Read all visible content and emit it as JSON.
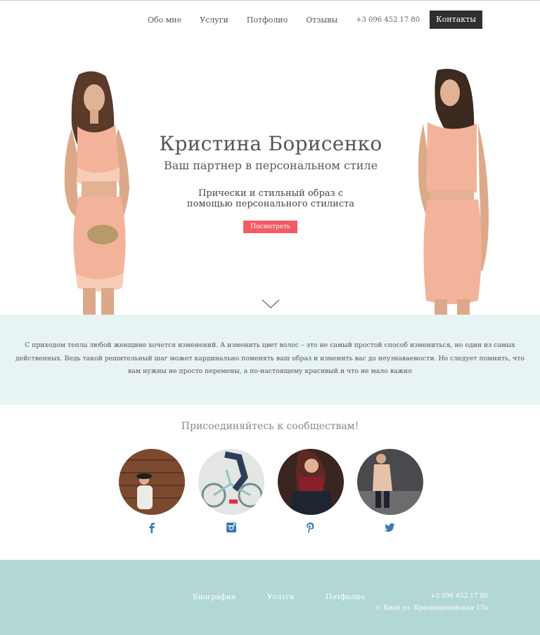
{
  "nav": {
    "items": [
      "Обо мне",
      "Услуги",
      "Потфолио",
      "Отзывы"
    ],
    "phone": "+3 096 452 17 80",
    "contacts_label": "Контакты"
  },
  "hero": {
    "name": "Кристина Борисенко",
    "subtitle": "Ваш партнер в персональном стиле",
    "desc_line1": "Прически и стильный образ с",
    "desc_line2": "помощью персонального стилиста",
    "button_label": "Посмотреть"
  },
  "about": {
    "text": "С приходом тепла любой женщине хочется изменений. А изменить цвет волос – это не самый простой способ измениться, но один из самых действенных. Ведь такой решительный шаг может кардинально поменять ваш образ и изменить вас до неузнаваемости. Но следует помнить, что вам нужны не просто перемены, а по-настоящему красивый и что не мало важно"
  },
  "community": {
    "title": "Присоединяйтесь к сообществам!",
    "socials": [
      "facebook-icon",
      "instagram-icon",
      "pinterest-icon",
      "twitter-icon"
    ]
  },
  "footer": {
    "links": [
      "Биография",
      "Услуги",
      "Потфолио"
    ],
    "phone": "+3 096 452 17 80",
    "address": "г. Киев ул. Красноармейская 17а"
  },
  "colors": {
    "accent_button": "#f35a64",
    "band": "#e8f3f3",
    "footer": "#b2d8d4",
    "social_blue": "#3b78b7",
    "contacts_bg": "#2f2f2f"
  }
}
